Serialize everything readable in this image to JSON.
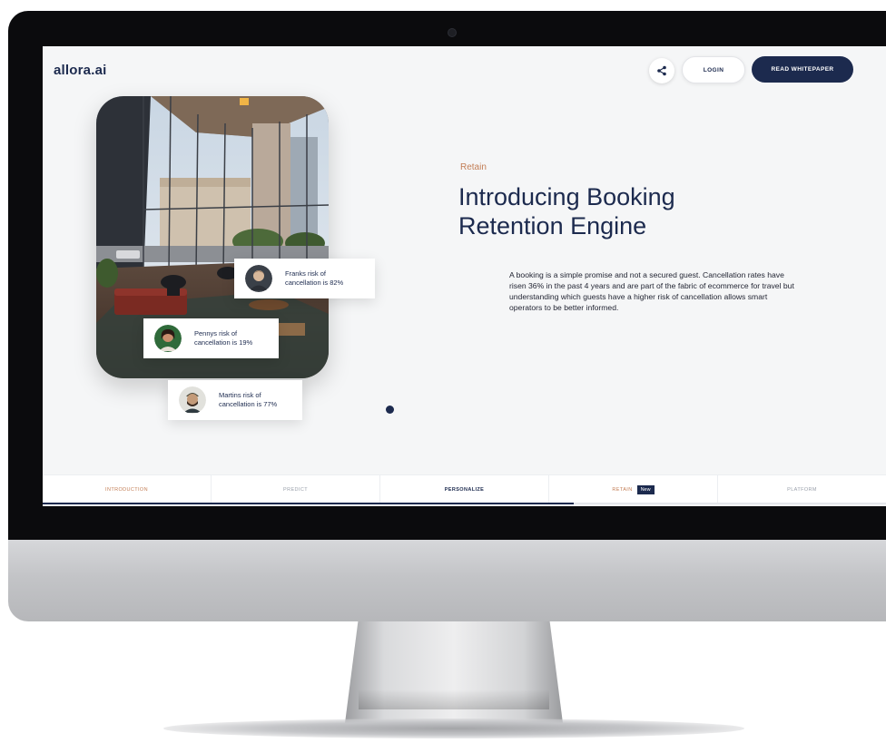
{
  "brand": {
    "logo": "allora.ai"
  },
  "header": {
    "share_icon": "share-icon",
    "login_label": "LOGIN",
    "whitepaper_label": "READ WHITEPAPER"
  },
  "hero": {
    "eyebrow": "Retain",
    "headline": "Introducing Booking Retention Engine",
    "body": "A booking is a simple promise and not a secured guest. Cancellation rates have risen 36% in the past 4 years and are part of the fabric of ecommerce for travel but understanding which guests have a higher risk of cancellation allows smart operators to be better informed."
  },
  "risk_cards": [
    {
      "text": "Franks risk of cancellation is 82%"
    },
    {
      "text": "Pennys risk of cancellation is 19%"
    },
    {
      "text": "Martins risk of cancellation is 77%"
    }
  ],
  "nav": {
    "tabs": [
      {
        "label": "INTRODUCTION"
      },
      {
        "label": "PREDICT"
      },
      {
        "label": "PERSONALIZE"
      },
      {
        "label": "RETAIN",
        "badge": "New"
      },
      {
        "label": "PLATFORM"
      }
    ],
    "progress": 0.63
  },
  "colors": {
    "navy": "#1c2a4e",
    "accent": "#c37e56",
    "screen_bg": "#f5f6f7"
  }
}
